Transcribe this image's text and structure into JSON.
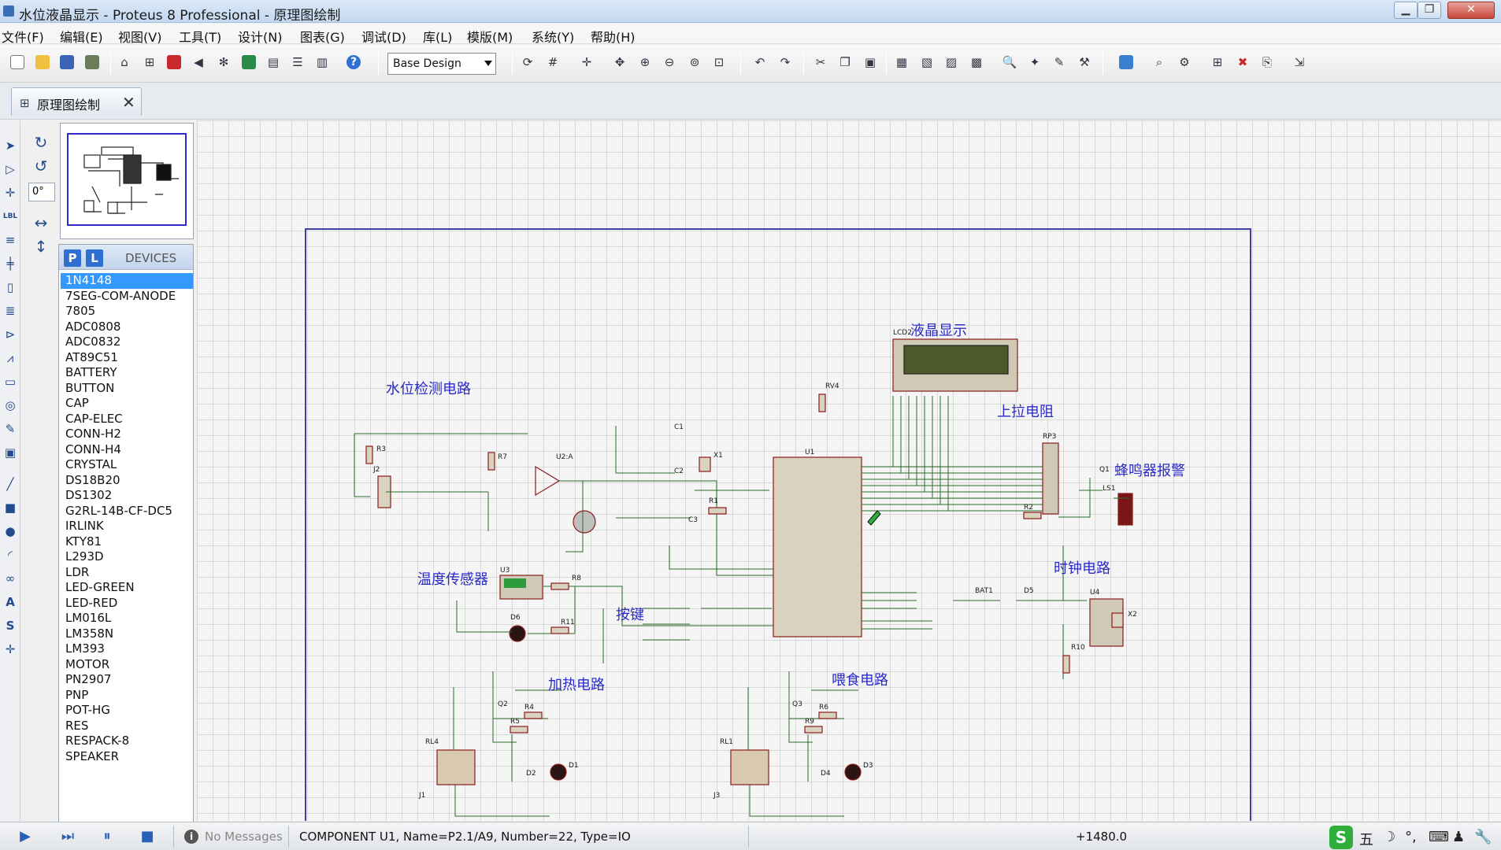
{
  "window": {
    "title": "水位液晶显示 - Proteus 8 Professional - 原理图绘制",
    "min_label": "▁",
    "max_label": "❐",
    "close_label": "✕"
  },
  "menu": [
    "文件(F)",
    "编辑(E)",
    "视图(V)",
    "工具(T)",
    "设计(N)",
    "图表(G)",
    "调试(D)",
    "库(L)",
    "模版(M)",
    "系统(Y)",
    "帮助(H)"
  ],
  "toolbar": {
    "layer_value": "Base Design",
    "icons": [
      "new-icon",
      "open-icon",
      "save-icon",
      "import-icon",
      "home-icon",
      "schematic-icon",
      "pcb-icon",
      "gerber-icon",
      "3d-icon",
      "bom-icon",
      "design-notes-icon",
      "netlist-icon",
      "report-icon",
      "help-icon",
      "refresh-icon",
      "grid-icon",
      "origin-icon",
      "pan-icon",
      "zoom-in-icon",
      "zoom-out-icon",
      "zoom-all-icon",
      "zoom-area-icon",
      "undo-icon",
      "redo-icon",
      "cut-icon",
      "copy-icon",
      "paste-icon",
      "block-copy-icon",
      "block-move-icon",
      "block-rotate-icon",
      "block-delete-icon",
      "pick-device-icon",
      "make-device-icon",
      "package-tool-icon",
      "decompose-icon",
      "wire-autorouter-icon",
      "search-icon",
      "property-tool-icon",
      "new-sheet-icon",
      "remove-sheet-icon",
      "goto-sheet-icon",
      "export-icon"
    ]
  },
  "tab": {
    "label": "原理图绘制",
    "close": "✕"
  },
  "rotation": "0°",
  "devices_panel": {
    "p_label": "P",
    "l_label": "L",
    "title": "DEVICES",
    "items": [
      "1N4148",
      "7SEG-COM-ANODE",
      "7805",
      "ADC0808",
      "ADC0832",
      "AT89C51",
      "BATTERY",
      "BUTTON",
      "CAP",
      "CAP-ELEC",
      "CONN-H2",
      "CONN-H4",
      "CRYSTAL",
      "DS18B20",
      "DS1302",
      "G2RL-14B-CF-DC5",
      "IRLINK",
      "KTY81",
      "L293D",
      "LDR",
      "LED-GREEN",
      "LED-RED",
      "LM016L",
      "LM358N",
      "LM393",
      "MOTOR",
      "PN2907",
      "PNP",
      "POT-HG",
      "RES",
      "RESPACK-8",
      "SPEAKER"
    ],
    "selected_index": 0
  },
  "schematic": {
    "labels": {
      "water": "水位检测电路",
      "lcd": "液晶显示",
      "pullup": "上拉电阻",
      "buzzer": "蜂鸣器报警",
      "temp": "温度传感器",
      "keys": "按键",
      "clock": "时钟电路",
      "heat": "加热电路",
      "feed": "喂食电路"
    },
    "refs": {
      "u1": "U1",
      "lcd": "LCD2",
      "rv": "RV4",
      "rp": "RP3",
      "q1": "Q1",
      "ls": "LS1",
      "u2": "U2:A",
      "u3": "U3",
      "u4": "U4",
      "j2": "J2",
      "r3": "R3",
      "r7": "R7",
      "c1": "C1",
      "c2": "C2",
      "c3": "C3",
      "x1": "X1",
      "r1": "R1",
      "r2": "R2",
      "r8": "R8",
      "r11": "R11",
      "d6": "D6",
      "bat": "BAT1",
      "d5": "D5",
      "x2": "X2",
      "r10": "R10",
      "q2": "Q2",
      "r4": "R4",
      "r5": "R5",
      "d1": "D1",
      "d2": "D2",
      "rl4": "RL4",
      "j1": "J1",
      "q3": "Q3",
      "r6": "R6",
      "r9": "R9",
      "d3": "D3",
      "d4": "D4",
      "rl1": "RL1",
      "j3": "J3"
    }
  },
  "status": {
    "messages": "No Messages",
    "component": "COMPONENT U1, Name=P2.1/A9, Number=22, Type=IO",
    "coord": "+1480.0",
    "ime_char": "五"
  }
}
